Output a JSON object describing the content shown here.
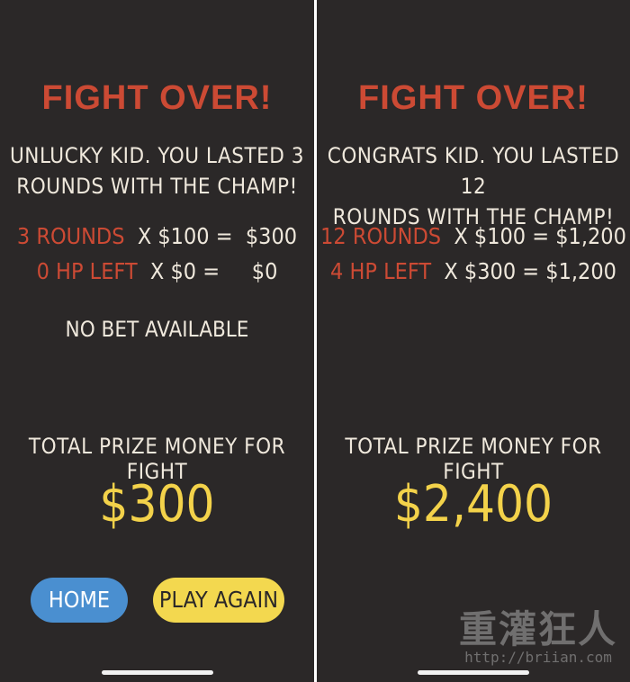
{
  "colors": {
    "background": "#2b2828",
    "divider": "#ffffff",
    "title": "#cc4a34",
    "text": "#efe8dc",
    "quantity": "#cc4a34",
    "prize": "#f3d24a",
    "home_button": "#4a8fd0",
    "play_again_button": "#f3d84f"
  },
  "left": {
    "title": "FIGHT OVER!",
    "subtitle_line1": "UNLUCKY KID. YOU LASTED 3",
    "subtitle_line2": "ROUNDS WITH THE CHAMP!",
    "row1": {
      "qty": "3 ROUNDS",
      "calc": "  X $100 =  $300"
    },
    "row2": {
      "qty": "0 HP LEFT",
      "calc": "  X $0 =     $0"
    },
    "note": "NO BET AVAILABLE",
    "total_label": "TOTAL PRIZE MONEY FOR FIGHT",
    "total_value": "$300",
    "home_label": "HOME",
    "play_again_label": "PLAY AGAIN"
  },
  "right": {
    "title": "FIGHT OVER!",
    "subtitle_line1": "CONGRATS KID. YOU LASTED 12",
    "subtitle_line2": "ROUNDS WITH THE CHAMP!",
    "row1": {
      "qty": "12 ROUNDS",
      "calc": "  X $100 = $1,200"
    },
    "row2": {
      "qty": "4 HP LEFT",
      "calc": "  X $300 = $1,200"
    },
    "total_label": "TOTAL PRIZE MONEY FOR FIGHT",
    "total_value": "$2,400"
  },
  "watermark": {
    "logo": "重灌狂人",
    "url": "http://briian.com"
  }
}
